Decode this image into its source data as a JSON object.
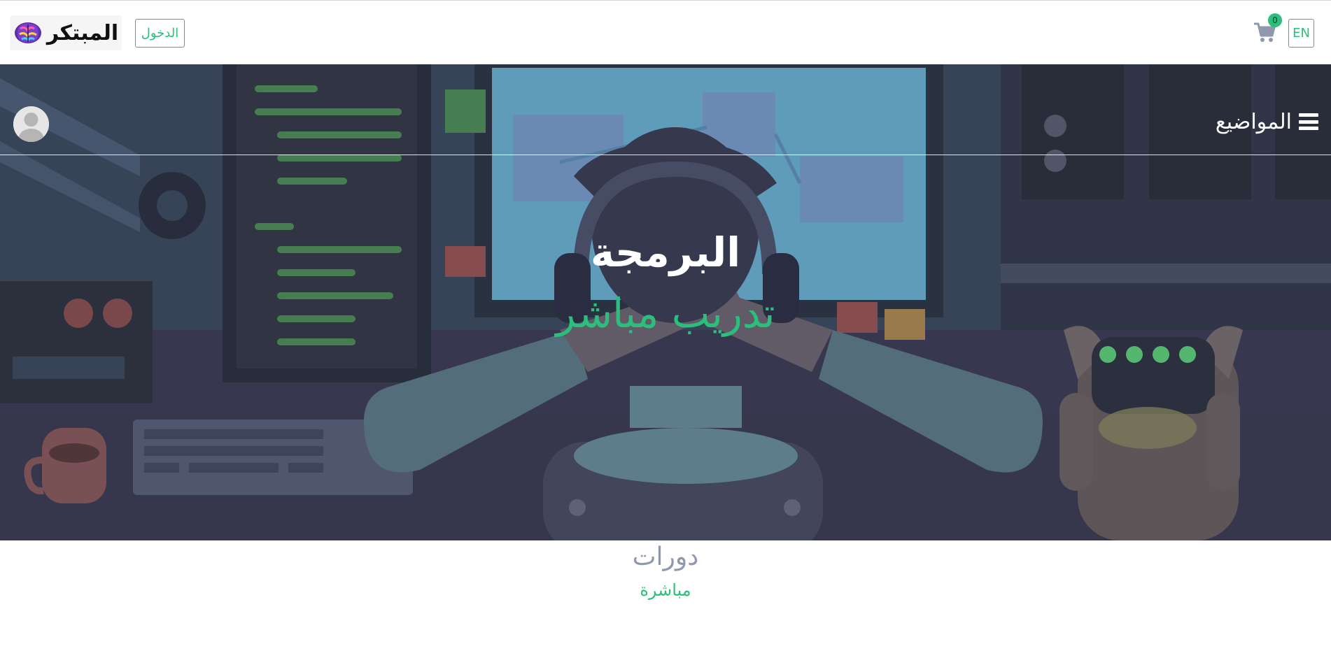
{
  "header": {
    "logo_text": "المبتكر",
    "login_label": "الدخول",
    "language_label": "EN",
    "cart_count": "0",
    "icons": {
      "brand": "brain-icon",
      "cart": "cart-icon"
    }
  },
  "hero": {
    "topics_label": "المواضيع",
    "title": "البرمجة",
    "subtitle": "تدريب مباشر",
    "icons": {
      "menu": "menu-icon",
      "avatar": "user-avatar-icon"
    }
  },
  "section": {
    "title": "دورات",
    "subtitle": "مباشرة"
  },
  "colors": {
    "accent": "#2bbf7d",
    "hero_bg": "#3b4258",
    "muted_title": "#8f98ad",
    "white": "#ffffff"
  }
}
